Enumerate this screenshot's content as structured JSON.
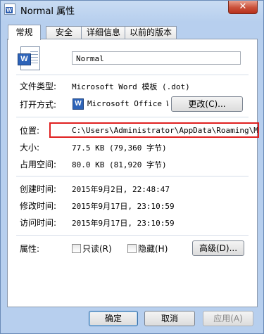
{
  "window": {
    "title": "Normal 属性",
    "close_label": "✕"
  },
  "tabs": [
    "常规",
    "安全",
    "详细信息",
    "以前的版本"
  ],
  "general": {
    "filename": "Normal",
    "file_type_label": "文件类型:",
    "file_type_value": "Microsoft Word 模板 (.dot)",
    "open_with_label": "打开方式:",
    "open_with_value": "Microsoft Office Wc",
    "change_button": "更改(C)...",
    "location_label": "位置:",
    "location_value": "C:\\Users\\Administrator\\AppData\\Roaming\\Mi",
    "size_label": "大小:",
    "size_value": "77.5 KB (79,360 字节)",
    "size_on_disk_label": "占用空间:",
    "size_on_disk_value": "80.0 KB (81,920 字节)",
    "created_label": "创建时间:",
    "created_value": "2015年9月2日, 22:48:47",
    "modified_label": "修改时间:",
    "modified_value": "2015年9月17日, 23:10:59",
    "accessed_label": "访问时间:",
    "accessed_value": "2015年9月17日, 23:10:59",
    "attributes_label": "属性:",
    "readonly_label": "只读(R)",
    "hidden_label": "隐藏(H)",
    "advanced_button": "高级(D)..."
  },
  "footer": {
    "ok": "确定",
    "cancel": "取消",
    "apply": "应用(A)"
  },
  "icons": {
    "word_doc": "word-document-icon",
    "word_app": "word-app-icon"
  },
  "colors": {
    "highlight_box": "#e02020",
    "title_bar": "#b7cfee"
  }
}
